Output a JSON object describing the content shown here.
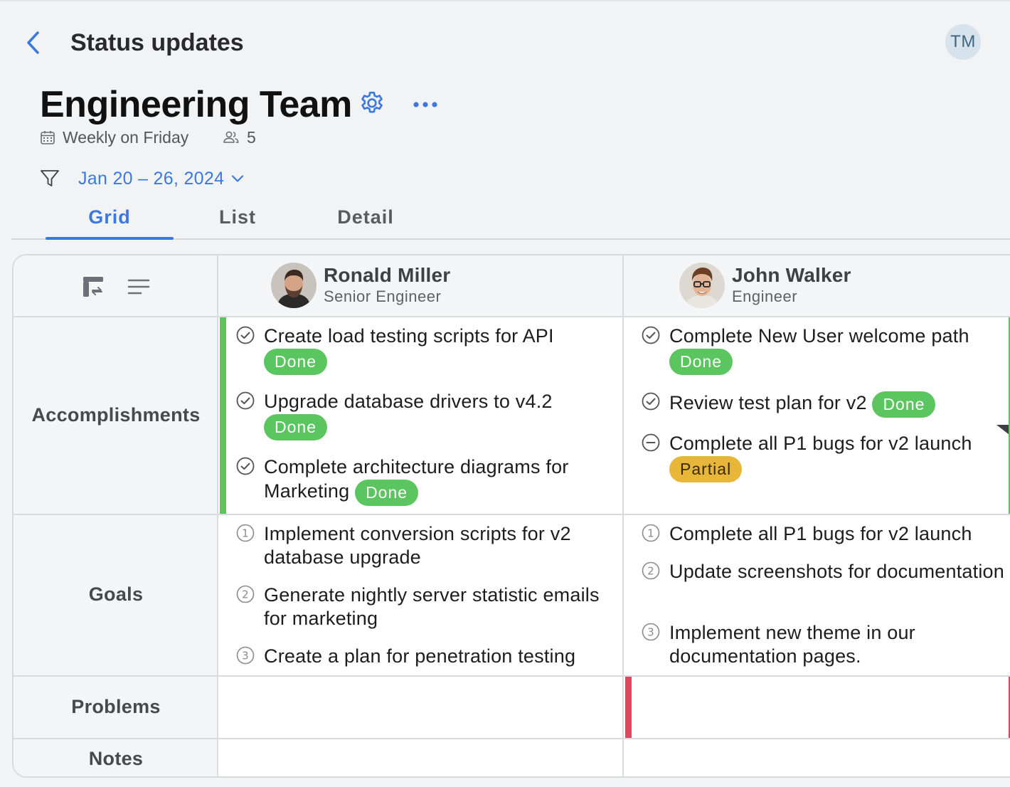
{
  "header": {
    "nav_title": "Status updates",
    "user_initials": "TM"
  },
  "team": {
    "name": "Engineering Team",
    "schedule": "Weekly on Friday",
    "member_count": "5"
  },
  "filter": {
    "date_range": "Jan 20 – 26, 2024"
  },
  "tabs": [
    {
      "label": "Grid",
      "active": true
    },
    {
      "label": "List",
      "active": false
    },
    {
      "label": "Detail",
      "active": false
    }
  ],
  "rows": {
    "accomplishments": "Accomplishments",
    "goals": "Goals",
    "problems": "Problems",
    "notes": "Notes"
  },
  "people": [
    {
      "name": "Ronald Miller",
      "role": "Senior Engineer",
      "accomplishments": [
        {
          "text": "Create load testing scripts for API",
          "status": "Done"
        },
        {
          "text": "Upgrade database drivers to v4.2",
          "status": "Done"
        },
        {
          "text": "Complete architecture diagrams for Marketing",
          "status": "Done"
        }
      ],
      "goals": [
        {
          "text": "Implement conversion scripts for v2 database upgrade"
        },
        {
          "text": "Generate nightly server statistic emails for marketing"
        },
        {
          "text": "Create a plan for penetration testing"
        }
      ]
    },
    {
      "name": "John Walker",
      "role": "Engineer",
      "accomplishments": [
        {
          "text": "Complete New User welcome path",
          "status": "Done"
        },
        {
          "text": "Review test plan for v2",
          "status": "Done"
        },
        {
          "text": "Complete all P1 bugs for v2 launch",
          "status": "Partial"
        }
      ],
      "goals": [
        {
          "text": "Complete all P1 bugs for v2 launch"
        },
        {
          "text": "Update screenshots for documentation"
        },
        {
          "text": "Implement new theme in our documentation pages."
        }
      ]
    }
  ],
  "colors": {
    "accent": "#3b79e0",
    "done": "#5bc560",
    "partial": "#e8b73a",
    "problem": "#e0475c"
  },
  "icons": [
    "chevron-left-icon",
    "gear-icon",
    "ellipsis-icon",
    "calendar-icon",
    "people-icon",
    "filter-icon",
    "chevron-down-icon",
    "swap-layout-icon",
    "text-lines-icon",
    "check-circle-icon",
    "minus-circle-icon"
  ]
}
